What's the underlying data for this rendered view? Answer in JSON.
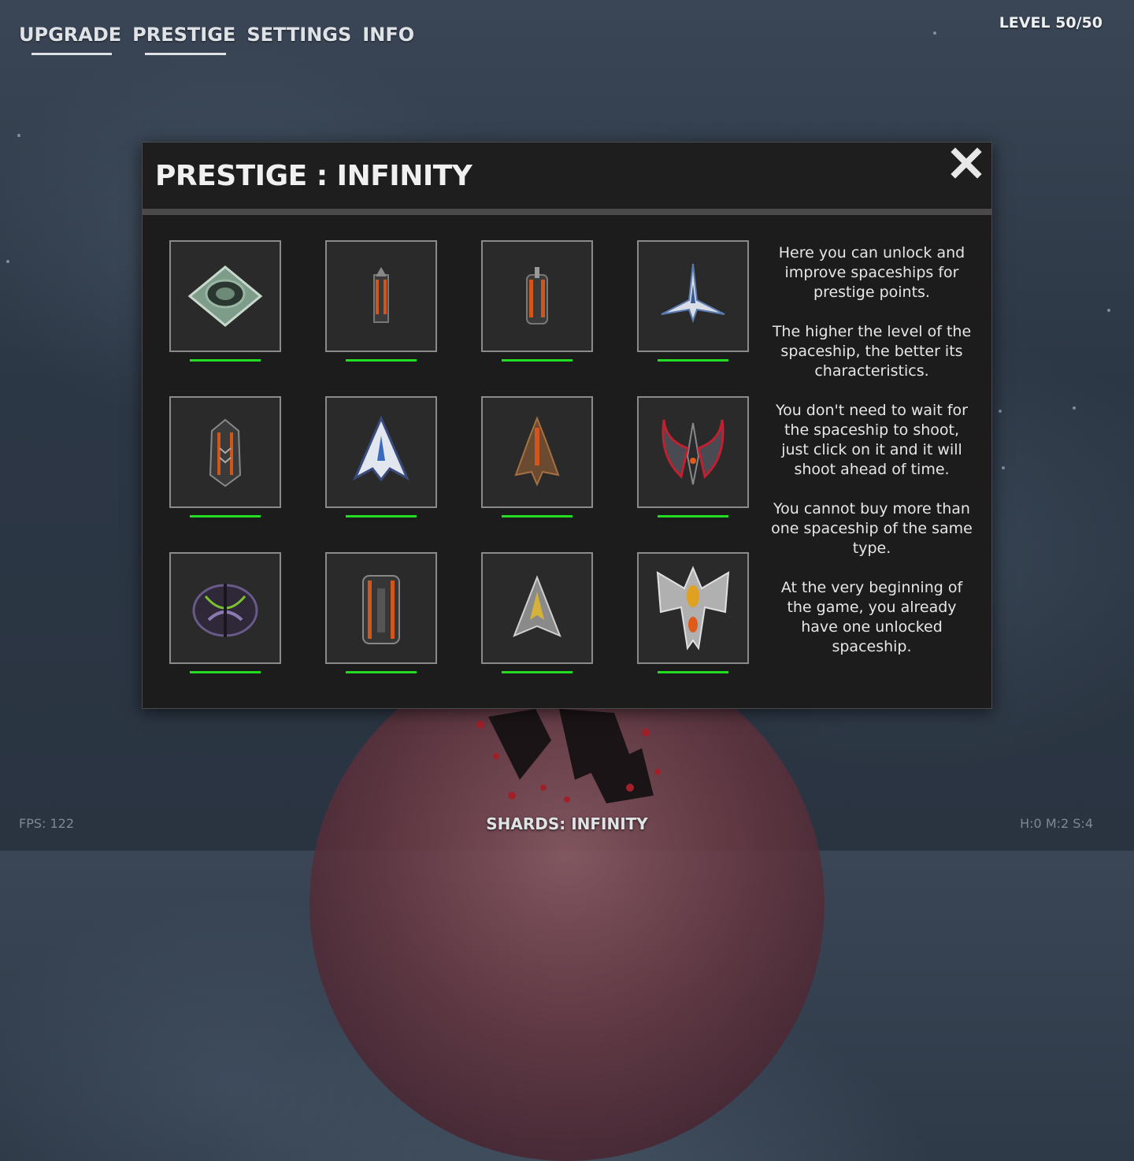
{
  "nav": {
    "items": [
      {
        "label": "UPGRADE",
        "active": true
      },
      {
        "label": "PRESTIGE",
        "active": true
      },
      {
        "label": "SETTINGS",
        "active": false
      },
      {
        "label": "INFO",
        "active": false
      }
    ]
  },
  "level_text": "LEVEL 50/50",
  "dialog": {
    "title": "PRESTIGE : INFINITY",
    "close_icon": "close-icon",
    "ships": [
      {
        "name": "ship-diamond",
        "unlocked": true
      },
      {
        "name": "ship-slim-orange",
        "unlocked": true
      },
      {
        "name": "ship-twin-orange",
        "unlocked": true
      },
      {
        "name": "ship-white-jet",
        "unlocked": true
      },
      {
        "name": "ship-armored-orange",
        "unlocked": true
      },
      {
        "name": "ship-white-arrow",
        "unlocked": true
      },
      {
        "name": "ship-bronze-fighter",
        "unlocked": true
      },
      {
        "name": "ship-red-wing",
        "unlocked": true
      },
      {
        "name": "ship-purple-claw",
        "unlocked": true
      },
      {
        "name": "ship-heavy-orange",
        "unlocked": true
      },
      {
        "name": "ship-silver-arrow",
        "unlocked": true
      },
      {
        "name": "ship-gold-mothership",
        "unlocked": true
      }
    ],
    "info_paragraphs": [
      "Here you can unlock and improve spaceships for prestige points.",
      "The higher the level of the spaceship, the better its characteristics.",
      "You don't need to wait for the spaceship to shoot, just click on it and it will shoot ahead of time.",
      "You cannot buy more than one spaceship of the same type.",
      "At the very beginning of the game, you already have one unlocked spaceship."
    ]
  },
  "footer": {
    "fps": "FPS: 122",
    "shards": "SHARDS: INFINITY",
    "hms": "H:0 M:2 S:4"
  },
  "colors": {
    "unlocked_bar": "#22dd22",
    "panel_bg": "#1c1c1c",
    "tile_border": "#8a8a8a"
  }
}
